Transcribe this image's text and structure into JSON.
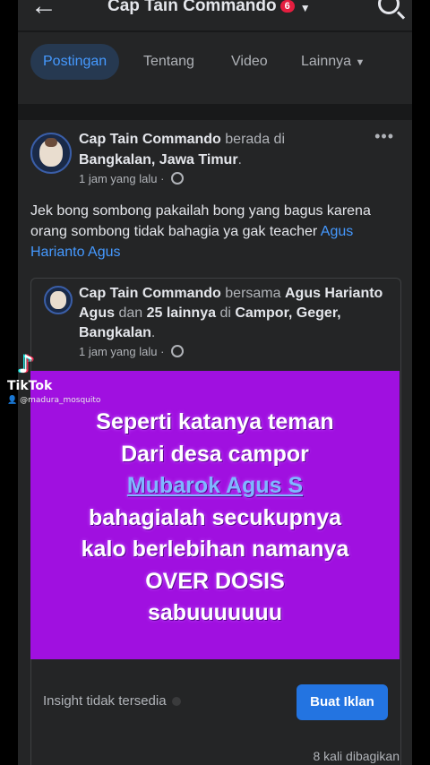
{
  "header": {
    "title": "Cap Tain Commando",
    "badge": "6"
  },
  "tabs": [
    {
      "label": "Postingan"
    },
    {
      "label": "Tentang"
    },
    {
      "label": "Video"
    },
    {
      "label": "Lainnya"
    }
  ],
  "post": {
    "author": "Cap Tain Commando",
    "location_prefix": "berada di",
    "location": "Bangkalan, Jawa Timur",
    "time": "1 jam yang lalu",
    "text": "Jek bong sombong pakailah bong yang bagus karena orang sombong tidak bahagia ya gak teacher",
    "mention": "Agus Harianto Agus"
  },
  "shared": {
    "author": "Cap Tain Commando",
    "with_word": "bersama",
    "with_person": "Agus Harianto Agus",
    "and_word": "dan",
    "others": "25 lainnya",
    "at_word": "di",
    "place": "Campor, Geger, Bangkalan",
    "time": "1 jam yang lalu",
    "image_lines": [
      "Seperti katanya teman",
      "Dari desa campor",
      "Mubarok Agus S",
      "bahagialah secukupnya",
      "kalo berlebihan namanya",
      "OVER DOSIS",
      "sabuuuuuuu"
    ]
  },
  "footer": {
    "insight": "Insight tidak tersedia",
    "button": "Buat Iklan",
    "shares": "8 kali dibagikan"
  },
  "watermark": {
    "brand": "TikTok",
    "user": "@madura_mosquito"
  },
  "colors": {
    "background": "#18191a",
    "card": "#242526",
    "accent": "#4599ff",
    "button": "#2374e1",
    "image_bg": "#a010e0"
  }
}
